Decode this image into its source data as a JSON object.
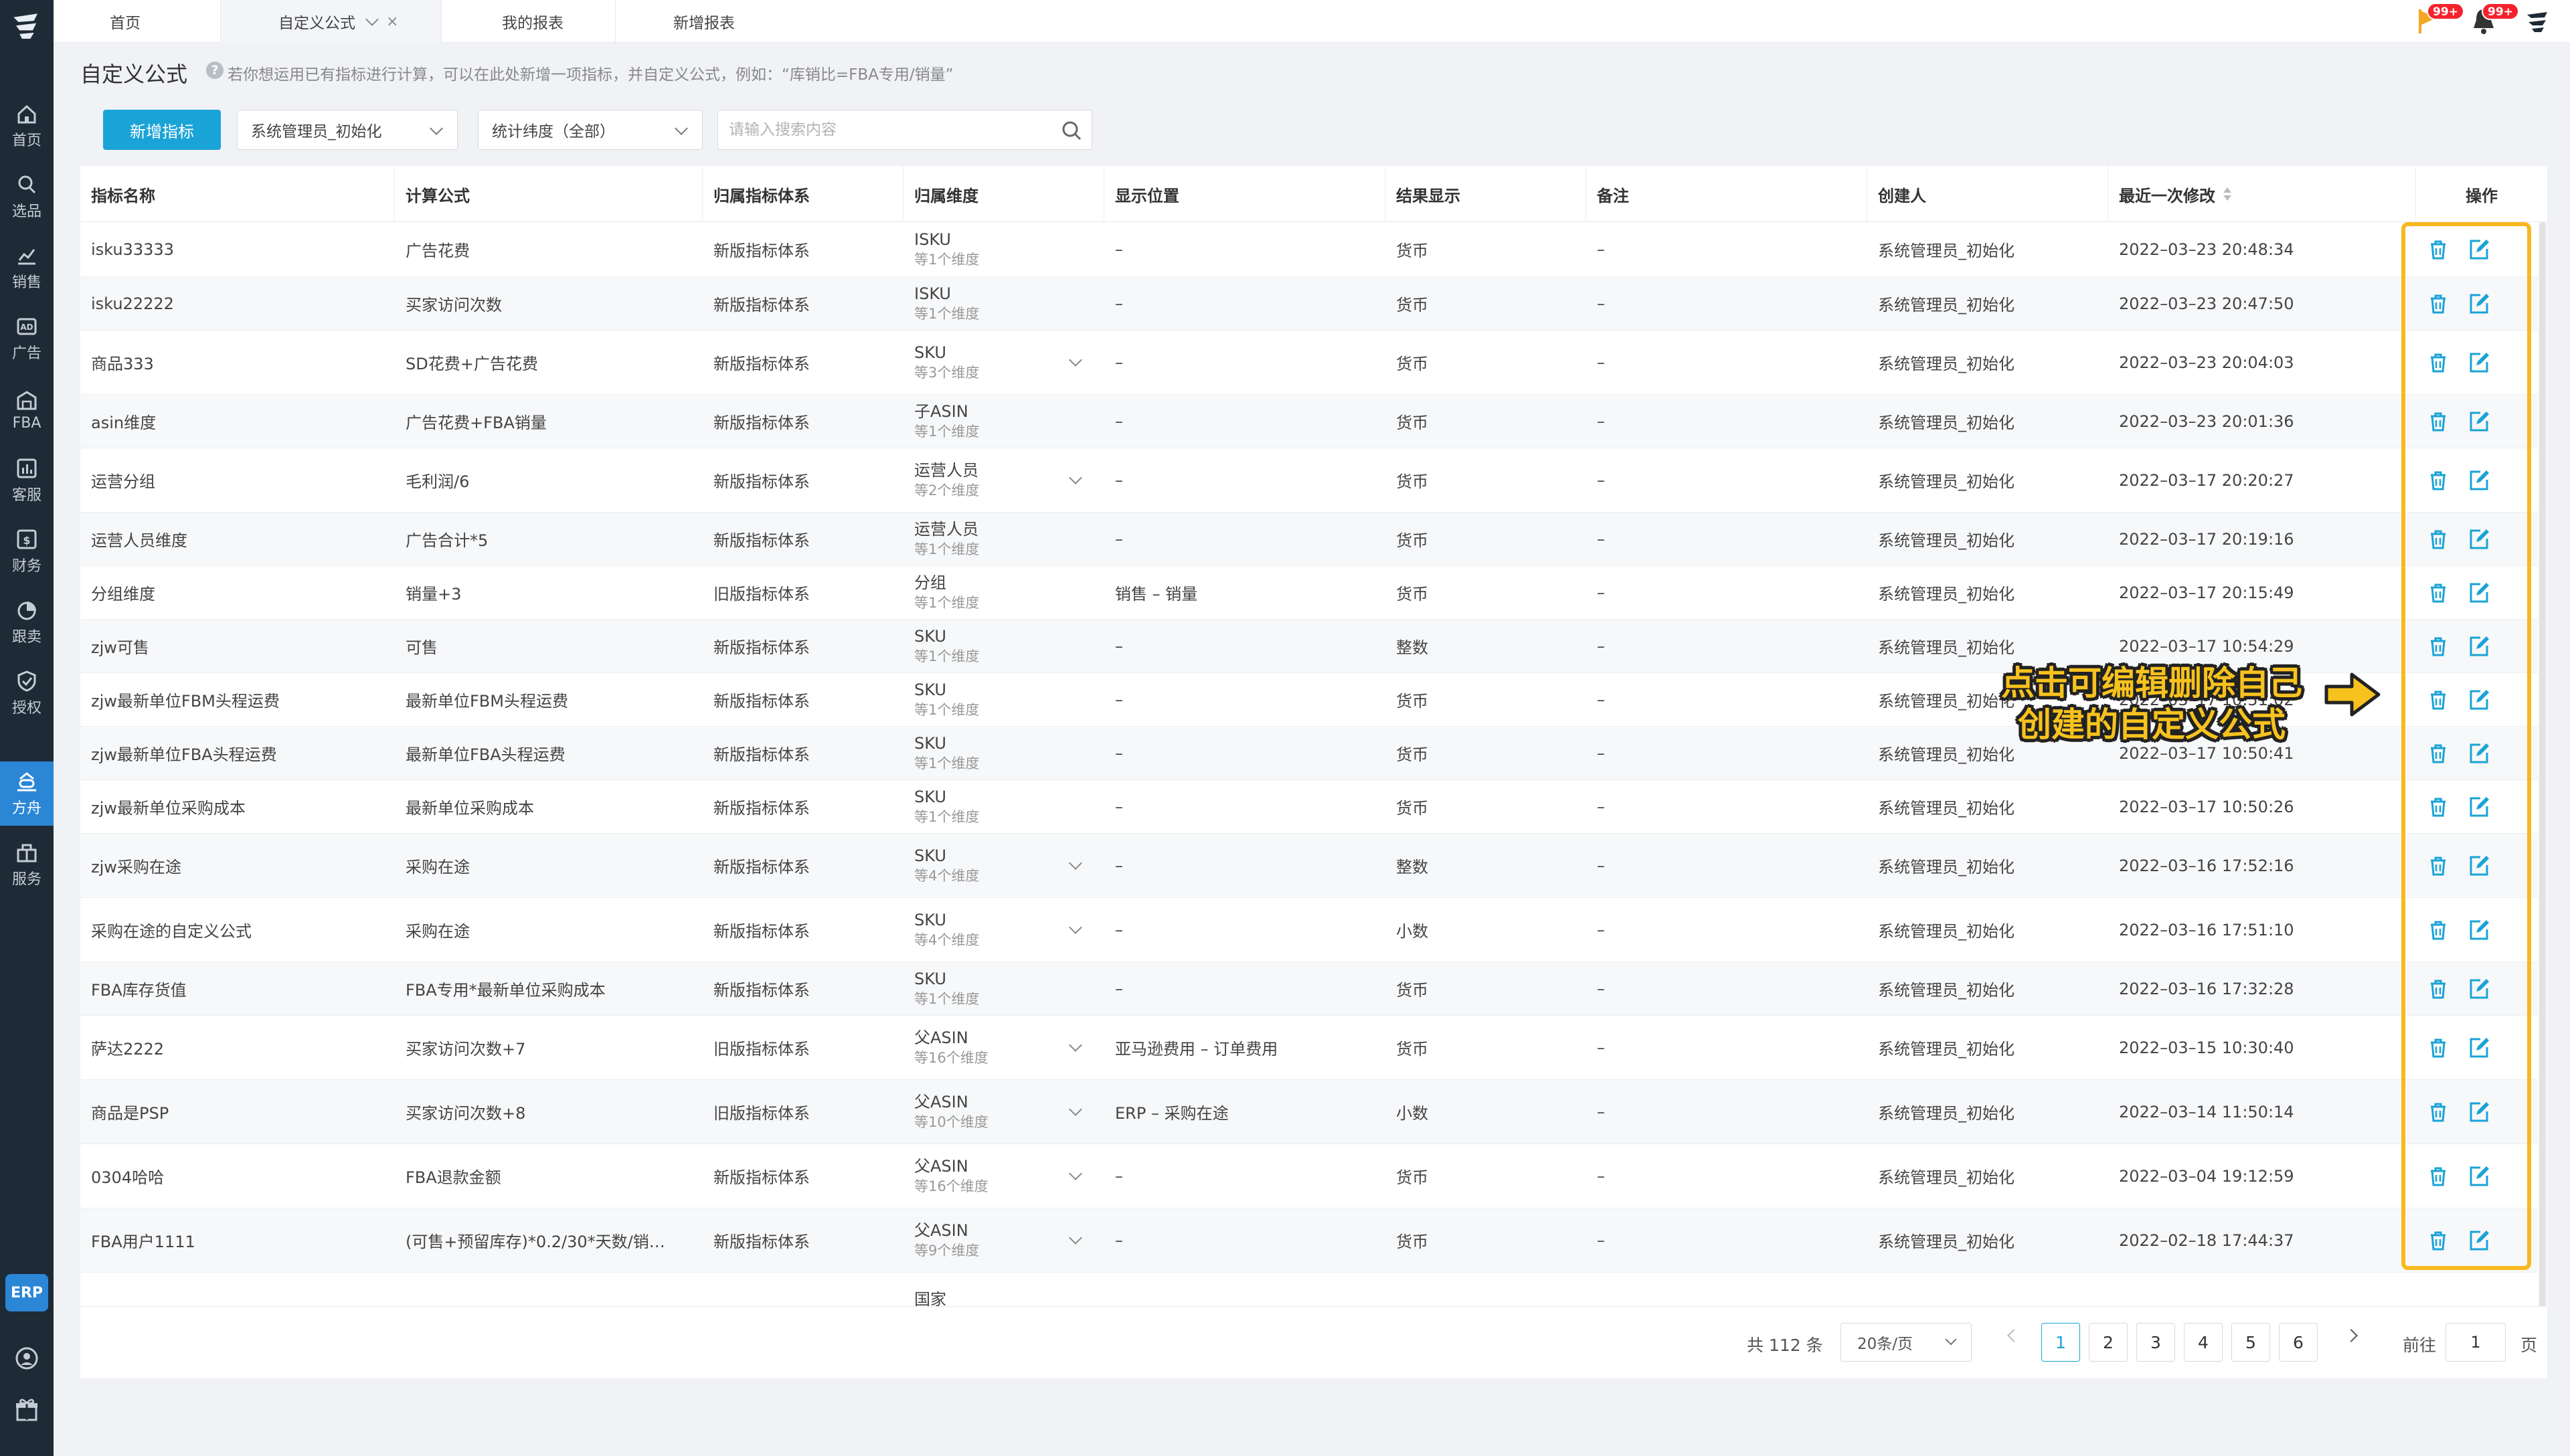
{
  "tabs": [
    {
      "label": "首页"
    },
    {
      "label": "自定义公式",
      "close": "×"
    },
    {
      "label": "我的报表"
    },
    {
      "label": "新增报表"
    }
  ],
  "top_badges": {
    "flag": "99+",
    "bell": "99+"
  },
  "sidebar": {
    "items": [
      {
        "label": "首页",
        "icon": "home-icon"
      },
      {
        "label": "选品",
        "icon": "search-icon"
      },
      {
        "label": "销售",
        "icon": "chart-line-icon"
      },
      {
        "label": "广告",
        "icon": "ad-icon"
      },
      {
        "label": "FBA",
        "icon": "warehouse-icon"
      },
      {
        "label": "客服",
        "icon": "chart-bar-icon"
      },
      {
        "label": "财务",
        "icon": "finance-icon"
      },
      {
        "label": "跟卖",
        "icon": "pie-icon"
      },
      {
        "label": "授权",
        "icon": "shield-icon"
      },
      {
        "label": "方舟",
        "icon": "ark-icon"
      },
      {
        "label": "服务",
        "icon": "service-icon"
      }
    ],
    "erp": "ERP"
  },
  "page": {
    "title": "自定义公式",
    "hint": "若你想运用已有指标进行计算，可以在此处新增一项指标，并自定义公式，例如：“库销比=FBA专用/销量”"
  },
  "toolbar": {
    "add_button": "新增指标",
    "creator_select": "系统管理员_初始化",
    "dimension_select": "统计纬度（全部）",
    "search_placeholder": "请输入搜索内容"
  },
  "table": {
    "headers": [
      "指标名称",
      "计算公式",
      "归属指标体系",
      "归属维度",
      "显示位置",
      "结果显示",
      "备注",
      "创建人",
      "最近一次修改",
      "操作"
    ],
    "rows": [
      {
        "name": "isku33333",
        "formula": "广告花费",
        "system": "新版指标体系",
        "dim": "ISKU",
        "dim_sub": "等1个维度",
        "pos": "–",
        "result": "货币",
        "note": "–",
        "creator": "系统管理员_初始化",
        "modified": "2022–03–23 20:48:34"
      },
      {
        "name": "isku22222",
        "formula": "买家访问次数",
        "system": "新版指标体系",
        "dim": "ISKU",
        "dim_sub": "等1个维度",
        "pos": "–",
        "result": "货币",
        "note": "–",
        "creator": "系统管理员_初始化",
        "modified": "2022–03–23 20:47:50"
      },
      {
        "name": "商品333",
        "formula": "SD花费+广告花费",
        "system": "新版指标体系",
        "dim": "SKU",
        "dim_sub": "等3个维度",
        "pos": "–",
        "result": "货币",
        "note": "–",
        "creator": "系统管理员_初始化",
        "modified": "2022–03–23 20:04:03"
      },
      {
        "name": "asin维度",
        "formula": "广告花费+FBA销量",
        "system": "新版指标体系",
        "dim": "子ASIN",
        "dim_sub": "等1个维度",
        "pos": "–",
        "result": "货币",
        "note": "–",
        "creator": "系统管理员_初始化",
        "modified": "2022–03–23 20:01:36"
      },
      {
        "name": "运营分组",
        "formula": "毛利润/6",
        "system": "新版指标体系",
        "dim": "运营人员",
        "dim_sub": "等2个维度",
        "pos": "–",
        "result": "货币",
        "note": "–",
        "creator": "系统管理员_初始化",
        "modified": "2022–03–17 20:20:27"
      },
      {
        "name": "运营人员维度",
        "formula": "广告合计*5",
        "system": "新版指标体系",
        "dim": "运营人员",
        "dim_sub": "等1个维度",
        "pos": "–",
        "result": "货币",
        "note": "–",
        "creator": "系统管理员_初始化",
        "modified": "2022–03–17 20:19:16"
      },
      {
        "name": "分组维度",
        "formula": "销量+3",
        "system": "旧版指标体系",
        "dim": "分组",
        "dim_sub": "等1个维度",
        "pos": "销售 – 销量",
        "result": "货币",
        "note": "–",
        "creator": "系统管理员_初始化",
        "modified": "2022–03–17 20:15:49"
      },
      {
        "name": "zjw可售",
        "formula": "可售",
        "system": "新版指标体系",
        "dim": "SKU",
        "dim_sub": "等1个维度",
        "pos": "–",
        "result": "整数",
        "note": "–",
        "creator": "系统管理员_初始化",
        "modified": "2022–03–17 10:54:29"
      },
      {
        "name": "zjw最新单位FBM头程运费",
        "formula": "最新单位FBM头程运费",
        "system": "新版指标体系",
        "dim": "SKU",
        "dim_sub": "等1个维度",
        "pos": "–",
        "result": "货币",
        "note": "–",
        "creator": "系统管理员_初始化",
        "modified": "2022–03–17 10:51:02"
      },
      {
        "name": "zjw最新单位FBA头程运费",
        "formula": "最新单位FBA头程运费",
        "system": "新版指标体系",
        "dim": "SKU",
        "dim_sub": "等1个维度",
        "pos": "–",
        "result": "货币",
        "note": "–",
        "creator": "系统管理员_初始化",
        "modified": "2022–03–17 10:50:41"
      },
      {
        "name": "zjw最新单位采购成本",
        "formula": "最新单位采购成本",
        "system": "新版指标体系",
        "dim": "SKU",
        "dim_sub": "等1个维度",
        "pos": "–",
        "result": "货币",
        "note": "–",
        "creator": "系统管理员_初始化",
        "modified": "2022–03–17 10:50:26"
      },
      {
        "name": "zjw采购在途",
        "formula": "采购在途",
        "system": "新版指标体系",
        "dim": "SKU",
        "dim_sub": "等4个维度",
        "pos": "–",
        "result": "整数",
        "note": "–",
        "creator": "系统管理员_初始化",
        "modified": "2022–03–16 17:52:16"
      },
      {
        "name": "采购在途的自定义公式",
        "formula": "采购在途",
        "system": "新版指标体系",
        "dim": "SKU",
        "dim_sub": "等4个维度",
        "pos": "–",
        "result": "小数",
        "note": "–",
        "creator": "系统管理员_初始化",
        "modified": "2022–03–16 17:51:10"
      },
      {
        "name": "FBA库存货值",
        "formula": "FBA专用*最新单位采购成本",
        "system": "新版指标体系",
        "dim": "SKU",
        "dim_sub": "等1个维度",
        "pos": "–",
        "result": "货币",
        "note": "–",
        "creator": "系统管理员_初始化",
        "modified": "2022–03–16 17:32:28"
      },
      {
        "name": "萨达2222",
        "formula": "买家访问次数+7",
        "system": "旧版指标体系",
        "dim": "父ASIN",
        "dim_sub": "等16个维度",
        "pos": "亚马逊费用 – 订单费用",
        "result": "货币",
        "note": "–",
        "creator": "系统管理员_初始化",
        "modified": "2022–03–15 10:30:40"
      },
      {
        "name": "商品是PSP",
        "formula": "买家访问次数+8",
        "system": "旧版指标体系",
        "dim": "父ASIN",
        "dim_sub": "等10个维度",
        "pos": "ERP – 采购在途",
        "result": "小数",
        "note": "–",
        "creator": "系统管理员_初始化",
        "modified": "2022–03–14 11:50:14"
      },
      {
        "name": "0304哈哈",
        "formula": "FBA退款金额",
        "system": "新版指标体系",
        "dim": "父ASIN",
        "dim_sub": "等16个维度",
        "pos": "–",
        "result": "货币",
        "note": "–",
        "creator": "系统管理员_初始化",
        "modified": "2022–03–04 19:12:59"
      },
      {
        "name": "FBA用户1111",
        "formula": "(可售+预留库存)*0.2/30*天数/销…",
        "system": "新版指标体系",
        "dim": "父ASIN",
        "dim_sub": "等9个维度",
        "pos": "–",
        "result": "货币",
        "note": "–",
        "creator": "系统管理员_初始化",
        "modified": "2022–02–18 17:44:37"
      },
      {
        "name": "",
        "formula": "",
        "system": "",
        "dim": "国家",
        "dim_sub": "",
        "pos": "",
        "result": "",
        "note": "",
        "creator": "",
        "modified": ""
      }
    ]
  },
  "annotation": {
    "line1": "点击可编辑删除自己",
    "line2": "创建的自定义公式"
  },
  "pagination": {
    "total": "共 112 条",
    "page_size": "20条/页",
    "pages": [
      "1",
      "2",
      "3",
      "4",
      "5",
      "6"
    ],
    "current": "1",
    "goto_label": "前往",
    "goto_value": "1",
    "goto_unit": "页"
  },
  "colors": {
    "accent": "#1aa3d6",
    "sidebar": "#1e2a36",
    "highlight": "#f7b91e"
  }
}
